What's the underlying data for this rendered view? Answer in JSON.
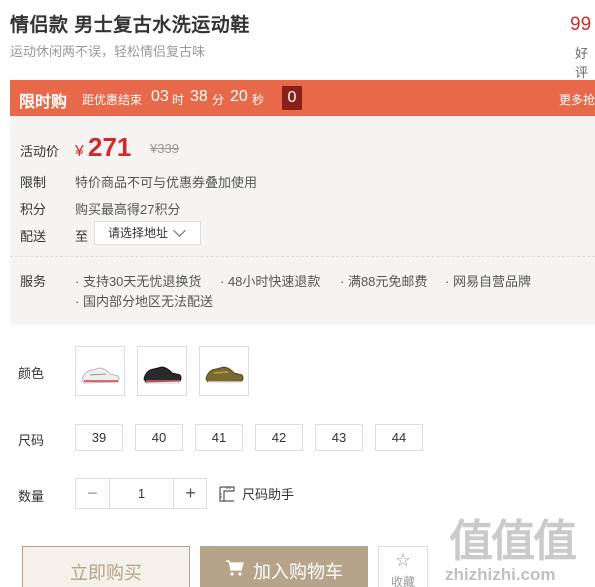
{
  "product": {
    "title": "情侣款 男士复古水洗运动鞋",
    "subtitle": "运动休闲两不误，轻松情侣复古味",
    "rating": "99",
    "rating_label": "好评"
  },
  "flash_sale": {
    "tag": "限时购",
    "ends_label": "距优惠结束",
    "hours": "03",
    "hours_unit": "时",
    "minutes": "38",
    "minutes_unit": "分",
    "seconds": "20",
    "seconds_unit": "秒",
    "extra": "0",
    "more": "更多抢"
  },
  "pricing": {
    "label": "活动价",
    "currency": "¥",
    "price": "271",
    "original": "¥339"
  },
  "restriction": {
    "label": "限制",
    "text": "特价商品不可与优惠券叠加使用"
  },
  "points": {
    "label": "积分",
    "text": "购买最高得27积分"
  },
  "delivery": {
    "label": "配送",
    "prefix": "至",
    "placeholder": "请选择地址"
  },
  "service": {
    "label": "服务",
    "items": [
      "支持30天无忧退换货",
      "48小时快速退款",
      "满88元免邮费",
      "网易自营品牌",
      "国内部分地区无法配送"
    ]
  },
  "color": {
    "label": "颜色"
  },
  "size": {
    "label": "尺码",
    "options": [
      "39",
      "40",
      "41",
      "42",
      "43",
      "44"
    ]
  },
  "quantity": {
    "label": "数量",
    "value": "1",
    "minus": "−",
    "plus": "+",
    "size_help": "尺码助手"
  },
  "actions": {
    "buy_now": "立即购买",
    "add_to_cart": "加入购物车",
    "favorite": "收藏"
  },
  "watermark": {
    "mark": "值值值",
    "url": "zhizhizhi.com"
  }
}
